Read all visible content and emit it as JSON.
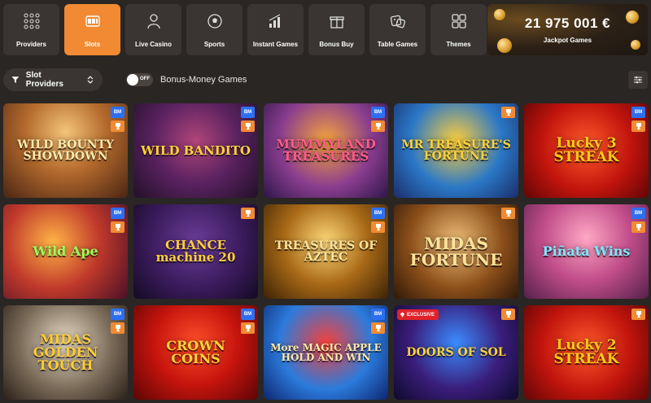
{
  "categories": [
    {
      "label": "Providers",
      "icon": "grid-dots-icon",
      "active": false
    },
    {
      "label": "Slots",
      "icon": "slot-machine-icon",
      "active": true
    },
    {
      "label": "Live Casino",
      "icon": "dealer-icon",
      "active": false
    },
    {
      "label": "Sports",
      "icon": "soccer-ball-icon",
      "active": false
    },
    {
      "label": "Instant Games",
      "icon": "bar-chart-icon",
      "active": false
    },
    {
      "label": "Bonus Buy",
      "icon": "gift-box-icon",
      "active": false
    },
    {
      "label": "Table Games",
      "icon": "dice-icon",
      "active": false
    },
    {
      "label": "Themes",
      "icon": "squares-icon",
      "active": false
    }
  ],
  "jackpot": {
    "amount": "21 975 001 €",
    "label": "Jackpot Games"
  },
  "filters": {
    "provider_label": "Slot Providers",
    "toggle_state": "OFF",
    "bonus_label": "Bonus-Money Games"
  },
  "badges": {
    "bm": "BM",
    "exclusive": "EXCLUSIVE"
  },
  "games": [
    {
      "title": "WILD BOUNTY SHOWDOWN",
      "bm": true,
      "trophy": true,
      "exclusive": false,
      "color": "#ffe9a8",
      "size": 14
    },
    {
      "title": "WILD BANDITO",
      "bm": true,
      "trophy": true,
      "exclusive": false,
      "color": "#ffd23a",
      "size": 15
    },
    {
      "title": "MUMMYLAND TREASURES",
      "bm": true,
      "trophy": true,
      "exclusive": false,
      "color": "#ff5a8a",
      "size": 15
    },
    {
      "title": "MR TREASURE'S FORTUNE",
      "bm": false,
      "trophy": true,
      "exclusive": false,
      "color": "#ffd23a",
      "size": 14
    },
    {
      "title": "Lucky 3 STREAK",
      "bm": true,
      "trophy": true,
      "exclusive": false,
      "color": "#ffc61a",
      "size": 17
    },
    {
      "title": "Wild Ape",
      "bm": true,
      "trophy": true,
      "exclusive": false,
      "color": "#9bff5a",
      "size": 16
    },
    {
      "title": "CHANCE machine 20",
      "bm": false,
      "trophy": true,
      "exclusive": false,
      "color": "#ffcf3a",
      "size": 15
    },
    {
      "title": "TREASURES OF AZTEC",
      "bm": true,
      "trophy": true,
      "exclusive": false,
      "color": "#ffe39a",
      "size": 14
    },
    {
      "title": "MIDAS FORTUNE",
      "bm": false,
      "trophy": true,
      "exclusive": false,
      "color": "#ffe39a",
      "size": 20
    },
    {
      "title": "Piñata Wins",
      "bm": true,
      "trophy": true,
      "exclusive": false,
      "color": "#7de8ff",
      "size": 16
    },
    {
      "title": "MIDAS GOLDEN TOUCH",
      "bm": true,
      "trophy": true,
      "exclusive": false,
      "color": "#ffcc33",
      "size": 16
    },
    {
      "title": "CROWN COINS",
      "bm": true,
      "trophy": true,
      "exclusive": false,
      "color": "#ffd23a",
      "size": 16
    },
    {
      "title": "More MAGIC APPLE HOLD AND WIN",
      "bm": true,
      "trophy": true,
      "exclusive": false,
      "color": "#ffe9a8",
      "size": 12
    },
    {
      "title": "DOORS OF SOL",
      "bm": false,
      "trophy": true,
      "exclusive": true,
      "color": "#ffd23a",
      "size": 14
    },
    {
      "title": "Lucky 2 STREAK",
      "bm": false,
      "trophy": true,
      "exclusive": false,
      "color": "#ffc61a",
      "size": 17
    }
  ]
}
